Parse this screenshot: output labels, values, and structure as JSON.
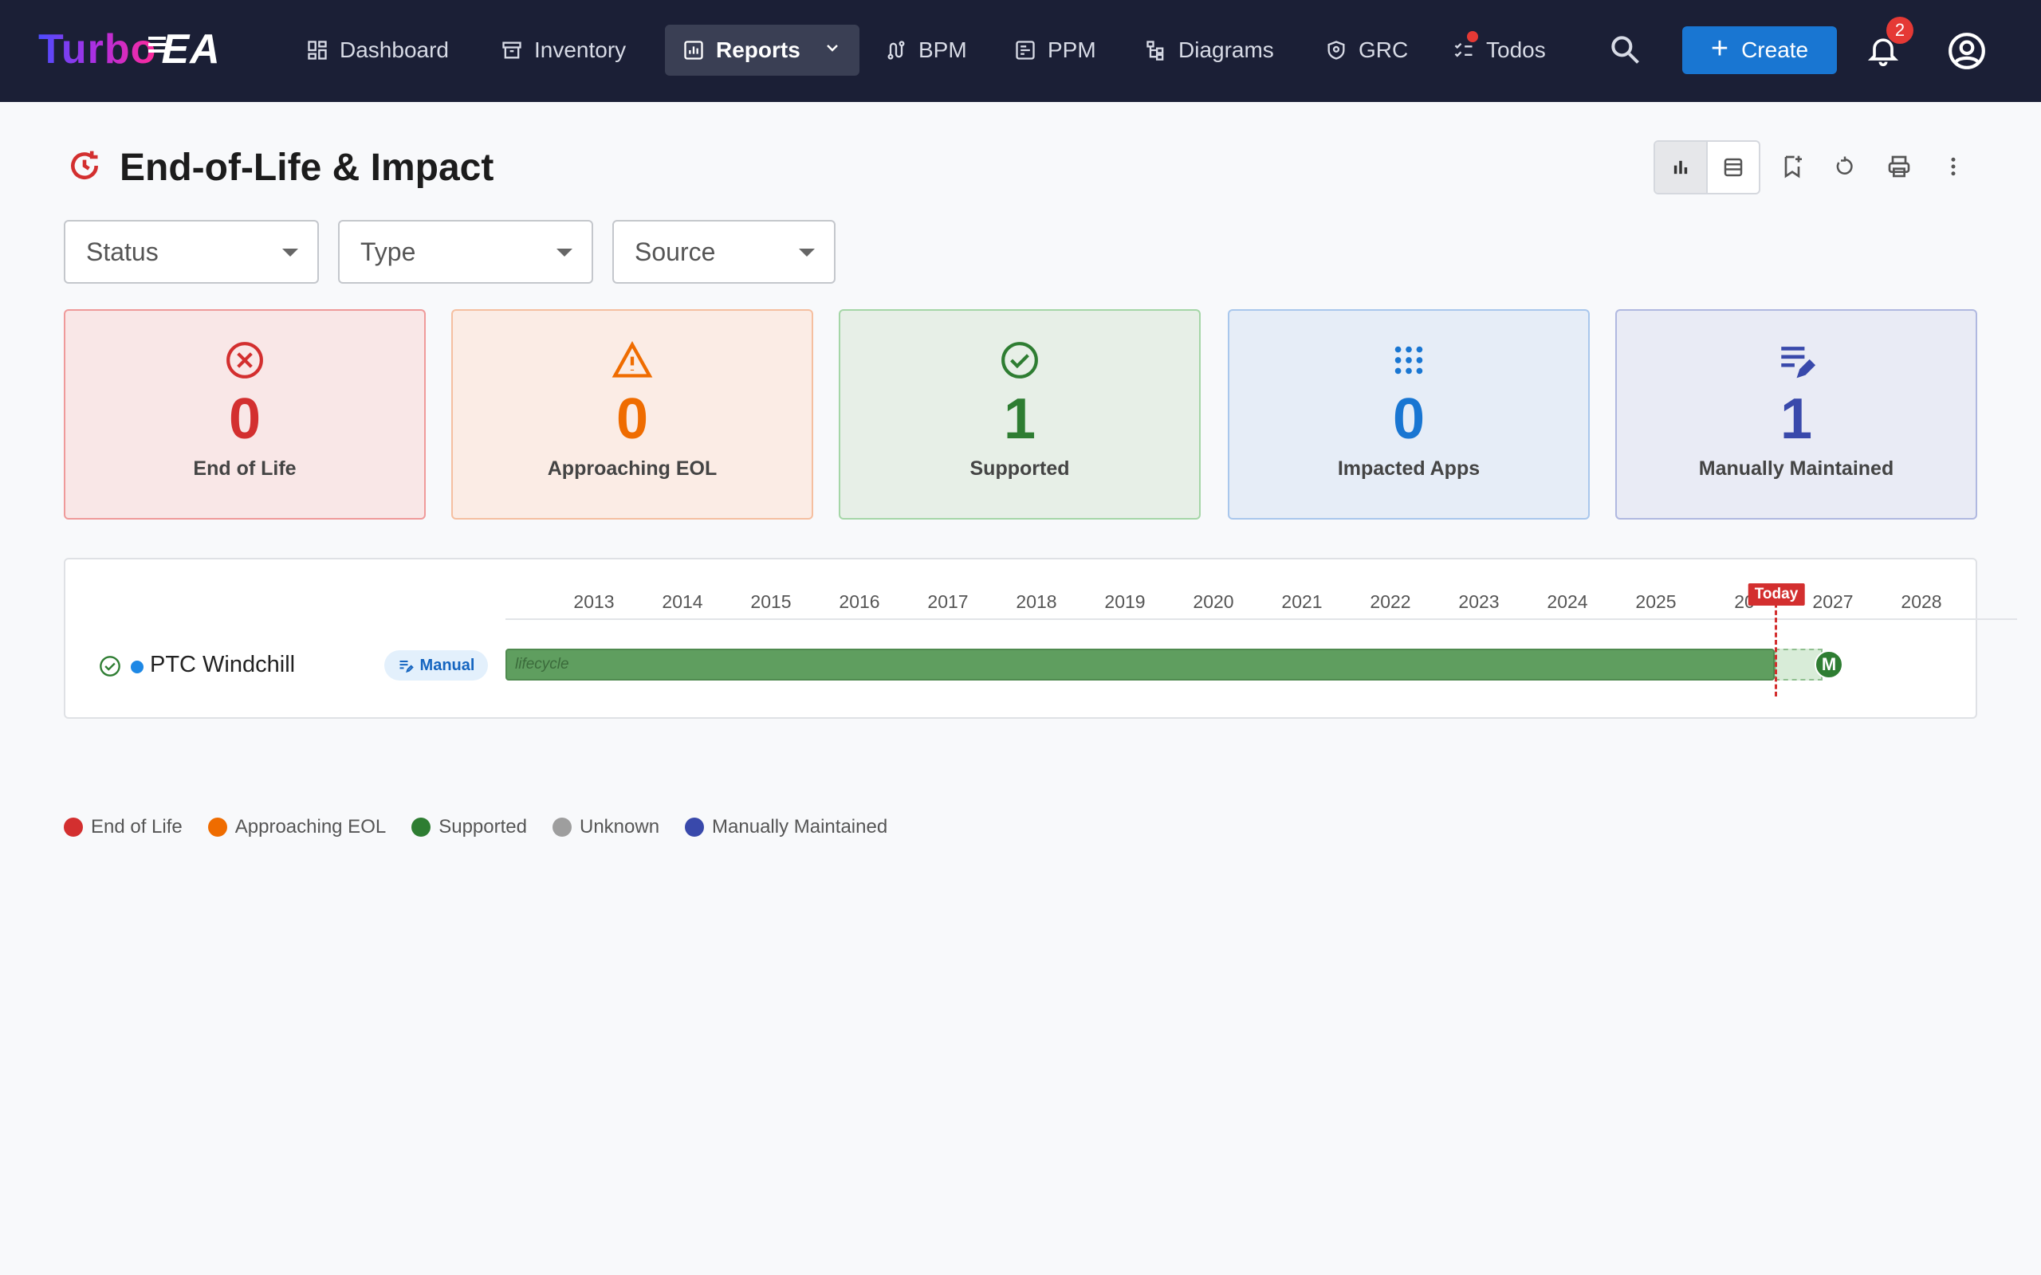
{
  "brand": {
    "part1": "Turbo",
    "part2": "EA"
  },
  "nav": {
    "items": [
      {
        "label": "Dashboard",
        "icon": "dashboard-icon"
      },
      {
        "label": "Inventory",
        "icon": "archive-icon"
      },
      {
        "label": "Reports",
        "icon": "bar-chart-icon",
        "active": true
      },
      {
        "label": "BPM",
        "icon": "route-icon"
      },
      {
        "label": "PPM",
        "icon": "board-icon"
      },
      {
        "label": "Diagrams",
        "icon": "tree-diagram-icon"
      },
      {
        "label": "GRC",
        "icon": "shield-icon"
      },
      {
        "label": "Todos",
        "icon": "checklist-icon"
      }
    ],
    "create_label": "Create",
    "notification_count": "2"
  },
  "page": {
    "title": "End-of-Life & Impact"
  },
  "filters": [
    {
      "label": "Status"
    },
    {
      "label": "Type"
    },
    {
      "label": "Source"
    }
  ],
  "kpis": [
    {
      "value": "0",
      "label": "End of Life",
      "color": "#d32f2f",
      "bg": "#f9e7e7",
      "border": "#ef9a9a"
    },
    {
      "value": "0",
      "label": "Approaching EOL",
      "color": "#ef6c00",
      "bg": "#fbece5",
      "border": "#f5bfa0"
    },
    {
      "value": "1",
      "label": "Supported",
      "color": "#2e7d32",
      "bg": "#e7efe7",
      "border": "#a5d6a7"
    },
    {
      "value": "0",
      "label": "Impacted Apps",
      "color": "#1976d2",
      "bg": "#e6edf7",
      "border": "#a9c7ec"
    },
    {
      "value": "1",
      "label": "Manually Maintained",
      "color": "#3949ab",
      "bg": "#e9ebf5",
      "border": "#b0b8e0"
    }
  ],
  "timeline": {
    "years": [
      "2013",
      "2014",
      "2015",
      "2016",
      "2017",
      "2018",
      "2019",
      "2020",
      "2021",
      "2022",
      "2023",
      "2024",
      "2025",
      "20",
      "2027",
      "2028"
    ],
    "today_label": "Today",
    "rows": [
      {
        "name": "PTC Windchill",
        "chip": "Manual",
        "bar_label": "lifecycle",
        "marker": "M"
      }
    ]
  },
  "legend": [
    {
      "label": "End of Life",
      "color": "#d32f2f"
    },
    {
      "label": "Approaching EOL",
      "color": "#ef6c00"
    },
    {
      "label": "Supported",
      "color": "#2e7d32"
    },
    {
      "label": "Unknown",
      "color": "#9e9e9e"
    },
    {
      "label": "Manually Maintained",
      "color": "#3949ab"
    }
  ]
}
